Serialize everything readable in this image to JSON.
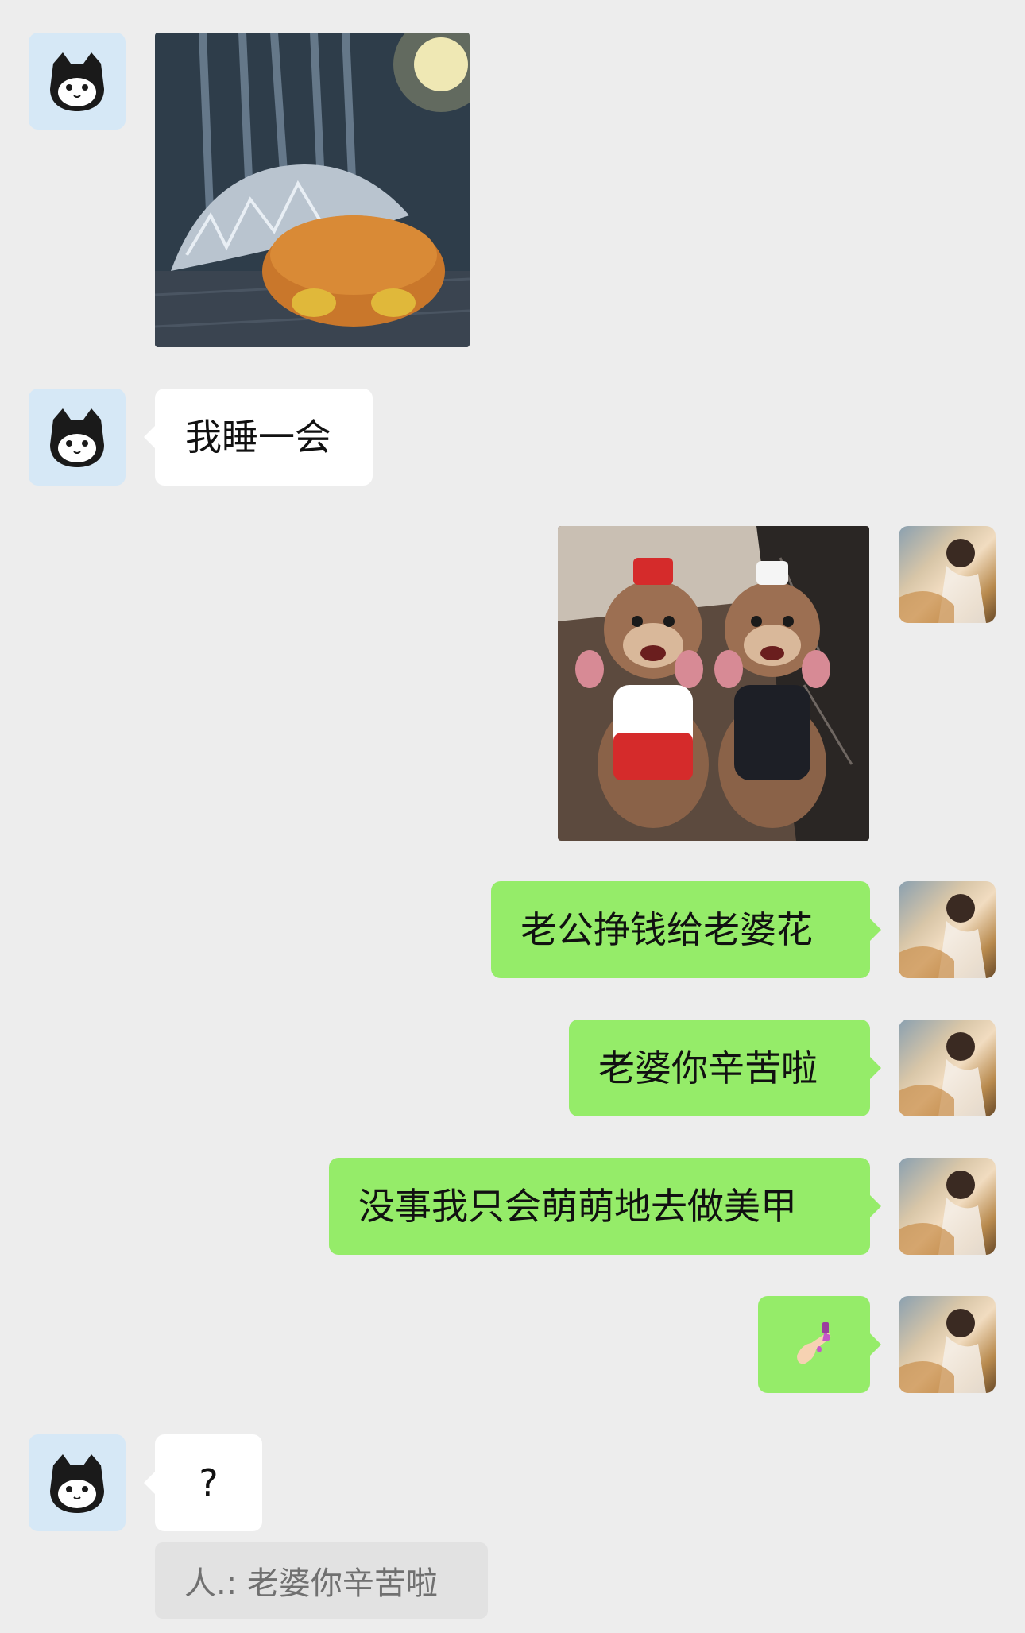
{
  "messages": {
    "m2_text": "我睡一会",
    "m4_text": "老公挣钱给老婆花",
    "m5_text": "老婆你辛苦啦",
    "m6_text": "没事我只会萌萌地去做美甲",
    "m7_emoji": "💅🏻",
    "m8_text": "?",
    "m8_quote": "人.:  老婆你辛苦啦"
  },
  "icons": {
    "left_avatar": "black-white-cat-avatar-icon",
    "right_avatar": "woman-photo-avatar",
    "sticker_1": "foil-wrapped-creature-sticker",
    "sticker_2": "two-otters-bottles-sticker"
  },
  "colors": {
    "background": "#ededed",
    "incoming_bubble": "#ffffff",
    "outgoing_bubble": "#95ec69",
    "quote_bg": "#e2e2e2"
  }
}
